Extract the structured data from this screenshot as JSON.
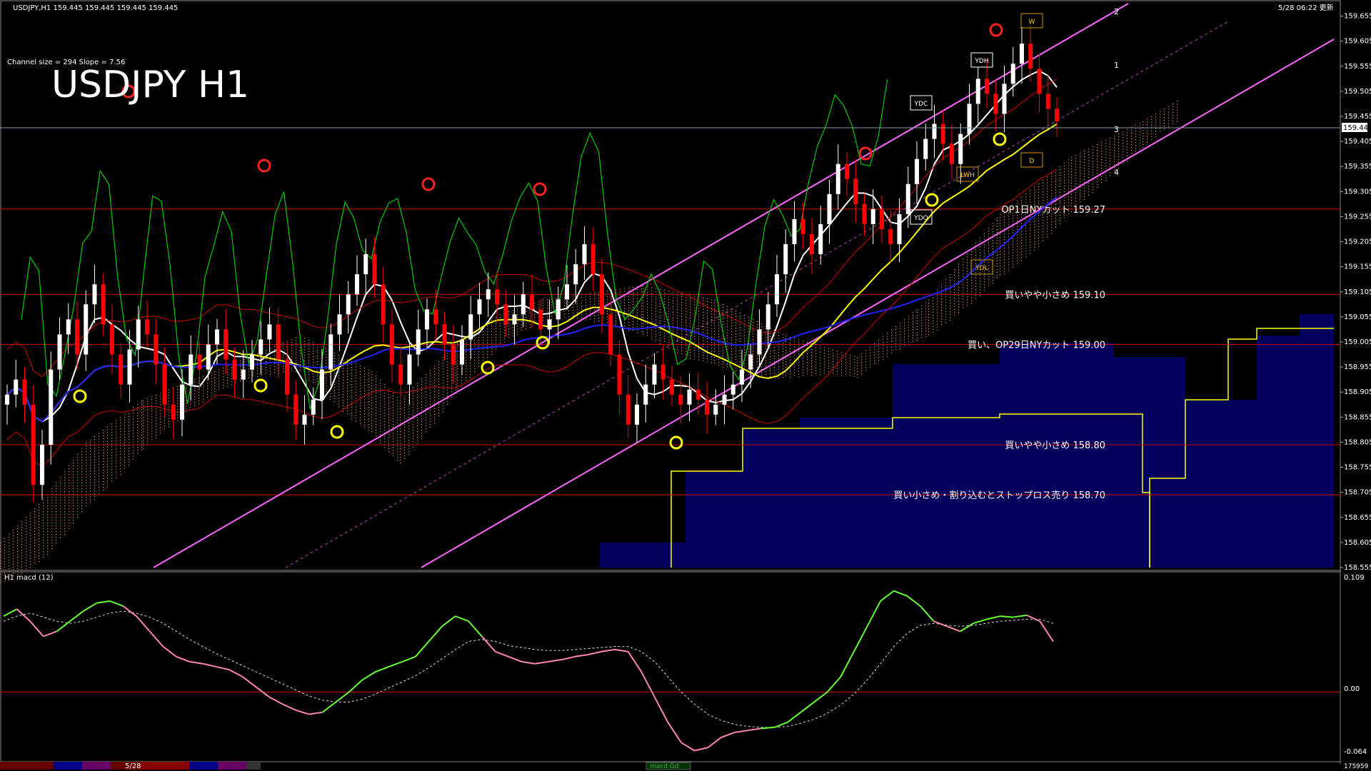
{
  "window": {
    "title": "USDJPY,H1  159.445 159.445 159.445 159.445",
    "datetime": "5/28 06:22 更新",
    "channel_info": "Channel size = 294 Slope = 7.56",
    "big_label": "USDJPY H1"
  },
  "colors": {
    "background": "#000000",
    "bull_candle": "#ffffff",
    "bear_candle": "#ff0000",
    "channel": "#ff66ff",
    "ma_white": "#ffffff",
    "ma_yellow": "#ffff00",
    "ma_blue": "#2222ff",
    "chikou": "#00cc00",
    "bollinger": "#cc0000",
    "hline": "#cc0000",
    "cloud_fill": "#000066",
    "kumo_dots": "#ff9966",
    "macd_up": "#66ff33",
    "macd_down": "#ff88aa"
  },
  "chart_data": [
    {
      "type": "candlestick",
      "title": "USDJPY H1",
      "ylim": [
        158.555,
        159.68
      ],
      "y_ticks": [
        "159.655",
        "159.605",
        "159.555",
        "159.505",
        "159.455",
        "159.405",
        "159.355",
        "159.305",
        "159.255",
        "159.205",
        "159.155",
        "159.105",
        "159.055",
        "159.005",
        "158.955",
        "158.905",
        "158.855",
        "158.805",
        "158.755",
        "158.705",
        "158.655",
        "158.605",
        "158.555"
      ],
      "current_price": "159.445",
      "horizontal_levels": [
        {
          "price": 159.27,
          "label": "OP1日NYカット 159.27"
        },
        {
          "price": 159.1,
          "label": "買いやや小さめ 159.10"
        },
        {
          "price": 159.0,
          "label": "買い、OP29日NYカット 159.00"
        },
        {
          "price": 158.8,
          "label": "買いやや小さめ 158.80"
        },
        {
          "price": 158.7,
          "label": "買い小さめ・割り込むとストップロス売り 158.70"
        }
      ],
      "markers": [
        "YDC",
        "YDH",
        "LWH",
        "YDO",
        "YDL",
        "W",
        "D"
      ],
      "fan_labels": [
        "1",
        "2",
        "3",
        "4"
      ],
      "closes": [
        158.9,
        158.93,
        158.88,
        158.72,
        158.8,
        158.95,
        159.02,
        159.05,
        158.98,
        159.08,
        159.12,
        159.04,
        158.98,
        158.92,
        158.99,
        159.05,
        159.02,
        158.96,
        158.88,
        158.85,
        158.92,
        158.98,
        158.95,
        159.0,
        159.03,
        158.97,
        158.93,
        158.95,
        158.98,
        159.01,
        159.04,
        158.97,
        158.9,
        158.84,
        158.86,
        158.89,
        158.95,
        159.02,
        159.06,
        159.1,
        159.14,
        159.18,
        159.12,
        159.04,
        158.96,
        158.92,
        158.98,
        159.03,
        159.07,
        159.04,
        159.0,
        158.96,
        159.01,
        159.06,
        159.09,
        159.11,
        159.08,
        159.04,
        159.06,
        159.1,
        159.07,
        159.03,
        159.05,
        159.09,
        159.12,
        159.16,
        159.2,
        159.14,
        159.06,
        158.98,
        158.9,
        158.84,
        158.88,
        158.92,
        158.96,
        158.93,
        158.9,
        158.88,
        158.91,
        158.89,
        158.86,
        158.88,
        158.9,
        158.92,
        158.95,
        158.98,
        159.03,
        159.08,
        159.14,
        159.2,
        159.25,
        159.22,
        159.18,
        159.24,
        159.3,
        159.36,
        159.33,
        159.28,
        159.24,
        159.27,
        159.23,
        159.2,
        159.26,
        159.32,
        159.37,
        159.41,
        159.44,
        159.4,
        159.36,
        159.42,
        159.48,
        159.53,
        159.5,
        159.46,
        159.52,
        159.56,
        159.6,
        159.55,
        159.5,
        159.47,
        159.445
      ],
      "macd": {
        "ylim": [
          -0.064,
          0.109
        ],
        "ticks": [
          "0.109",
          "0.00",
          "-0.064"
        ],
        "label": "H1  macd (12)",
        "main": [
          0.075,
          0.082,
          0.07,
          0.055,
          0.06,
          0.07,
          0.08,
          0.088,
          0.09,
          0.085,
          0.075,
          0.06,
          0.045,
          0.035,
          0.03,
          0.028,
          0.025,
          0.022,
          0.015,
          0.005,
          -0.005,
          -0.012,
          -0.018,
          -0.022,
          -0.02,
          -0.01,
          0.0,
          0.012,
          0.02,
          0.025,
          0.03,
          0.035,
          0.05,
          0.065,
          0.075,
          0.07,
          0.055,
          0.04,
          0.035,
          0.03,
          0.028,
          0.03,
          0.032,
          0.035,
          0.037,
          0.04,
          0.042,
          0.04,
          0.02,
          -0.005,
          -0.03,
          -0.05,
          -0.058,
          -0.055,
          -0.045,
          -0.04,
          -0.038,
          -0.036,
          -0.035,
          -0.03,
          -0.02,
          -0.01,
          0.0,
          0.015,
          0.04,
          0.065,
          0.09,
          0.1,
          0.095,
          0.085,
          0.07,
          0.065,
          0.06,
          0.068,
          0.072,
          0.075,
          0.074,
          0.076,
          0.07,
          0.05
        ],
        "signal": [
          0.07,
          0.075,
          0.078,
          0.074,
          0.07,
          0.068,
          0.07,
          0.074,
          0.078,
          0.08,
          0.078,
          0.074,
          0.068,
          0.06,
          0.052,
          0.045,
          0.038,
          0.032,
          0.026,
          0.02,
          0.014,
          0.008,
          0.002,
          -0.004,
          -0.008,
          -0.01,
          -0.01,
          -0.007,
          -0.002,
          0.004,
          0.01,
          0.016,
          0.024,
          0.033,
          0.042,
          0.05,
          0.052,
          0.05,
          0.046,
          0.044,
          0.042,
          0.041,
          0.041,
          0.042,
          0.043,
          0.044,
          0.045,
          0.045,
          0.04,
          0.03,
          0.015,
          0.0,
          -0.012,
          -0.022,
          -0.028,
          -0.032,
          -0.034,
          -0.035,
          -0.035,
          -0.034,
          -0.031,
          -0.027,
          -0.021,
          -0.013,
          -0.002,
          0.012,
          0.028,
          0.045,
          0.058,
          0.066,
          0.068,
          0.066,
          0.065,
          0.066,
          0.068,
          0.07,
          0.071,
          0.072,
          0.072,
          0.068
        ]
      }
    }
  ],
  "bottom_bar": {
    "date_label": "5/28",
    "indicator_tag": "macd Gd",
    "count": "175959"
  }
}
